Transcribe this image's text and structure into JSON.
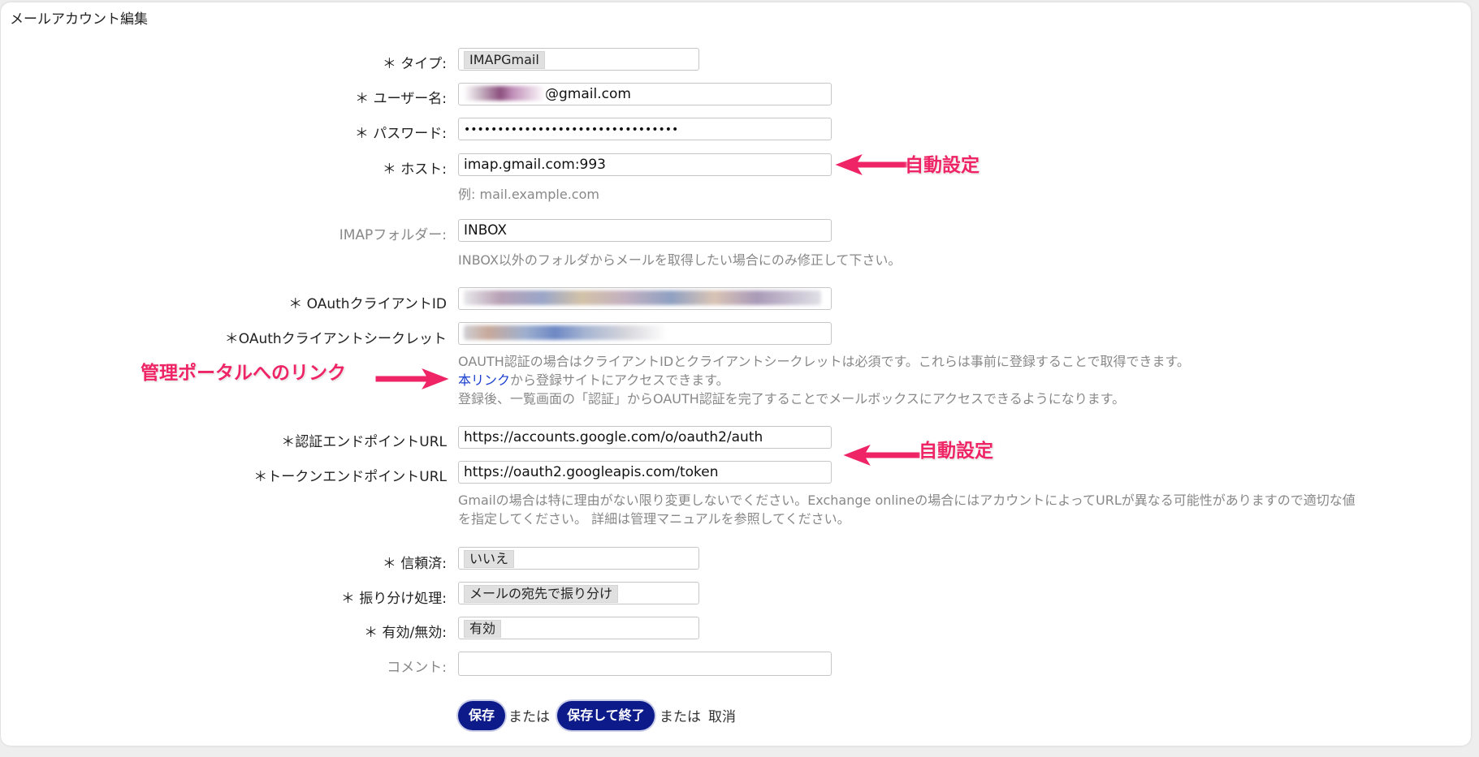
{
  "page": {
    "title": "メールアカウント編集"
  },
  "fields": {
    "type": {
      "label": "＊ タイプ:",
      "value": "IMAPGmail"
    },
    "username": {
      "label": "＊ ユーザー名:",
      "value_suffix": "@gmail.com"
    },
    "password": {
      "label": "＊ パスワード:",
      "value": "••••••••••••••••••••••••••••••••"
    },
    "host": {
      "label": "＊ ホスト:",
      "value": "imap.gmail.com:993",
      "hint": "例: mail.example.com"
    },
    "imap_folder": {
      "label": "IMAPフォルダー:",
      "value": "INBOX",
      "hint": "INBOX以外のフォルダからメールを取得したい場合にのみ修正して下さい。"
    },
    "client_id": {
      "label": "＊ OAuthクライアントID"
    },
    "client_secret": {
      "label": "＊OAuthクライアントシークレット"
    },
    "oauth_hint": {
      "line1": "OAUTH認証の場合はクライアントIDとクライアントシークレットは必須です。これらは事前に登録することで取得できます。",
      "link": "本リンク",
      "line2_rest": "から登録サイトにアクセスできます。",
      "line3": "登録後、一覧画面の「認証」からOAUTH認証を完了することでメールボックスにアクセスできるようになります。"
    },
    "auth_endpoint": {
      "label": "＊認証エンドポイントURL",
      "value": "https://accounts.google.com/o/oauth2/auth"
    },
    "token_endpoint": {
      "label": "＊トークンエンドポイントURL",
      "value": "https://oauth2.googleapis.com/token"
    },
    "endpoint_hint": {
      "line1": "Gmailの場合は特に理由がない限り変更しないでください。Exchange onlineの場合にはアカウントによってURLが異なる可能性がありますので適切な値",
      "line2": "を指定してください。 詳細は管理マニュアルを参照してください。"
    },
    "trusted": {
      "label": "＊ 信頼済:",
      "value": "いいえ"
    },
    "dispatch": {
      "label": "＊ 振り分け処理:",
      "value": "メールの宛先で振り分け"
    },
    "valid": {
      "label": "＊ 有効/無効:",
      "value": "有効"
    },
    "comment": {
      "label": "コメント:",
      "value": ""
    }
  },
  "actions": {
    "save": "保存",
    "or1": "または",
    "save_finish": "保存して終了",
    "or2": "または",
    "cancel": "取消"
  },
  "annotations": {
    "auto_setting_1": "自動設定",
    "portal_link": "管理ポータルへのリンク",
    "auto_setting_2": "自動設定"
  },
  "colors": {
    "annotation": "#ee2466",
    "button": "#0d1a8a",
    "link": "#1a3fcf",
    "hint": "#888888"
  }
}
